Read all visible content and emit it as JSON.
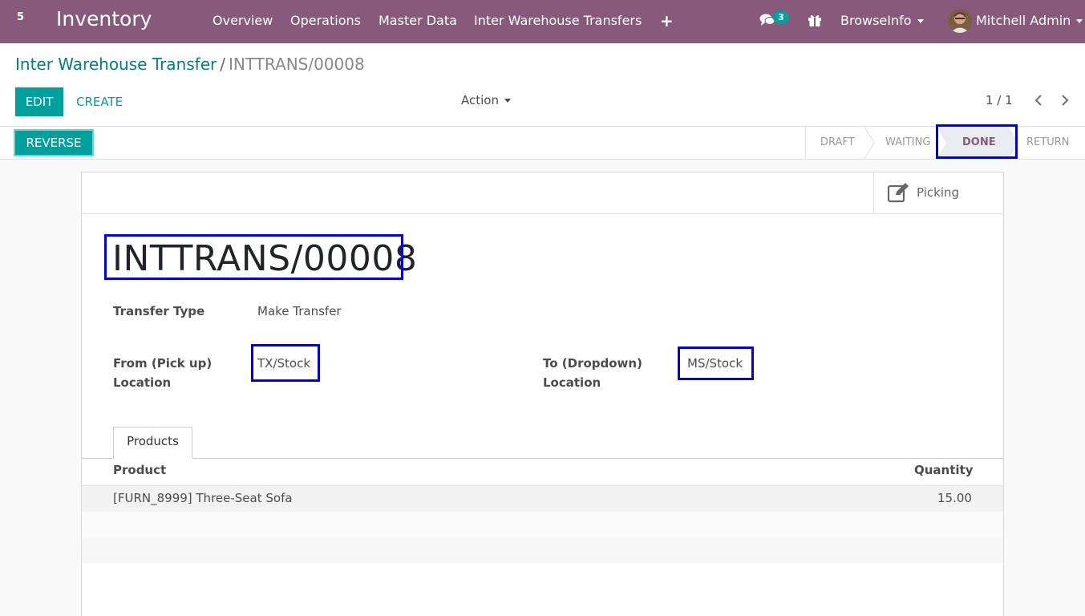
{
  "navbar": {
    "apps_count": "5",
    "brand": "Inventory",
    "menu": [
      "Overview",
      "Operations",
      "Master Data",
      "Inter Warehouse Transfers"
    ],
    "plus_icon": "+",
    "chat_badge": "3",
    "company": "BrowseInfo",
    "user": "Mitchell Admin",
    "colors": {
      "bar": "#875a7b",
      "badge": "#00a09d"
    }
  },
  "breadcrumb": {
    "parent": "Inter Warehouse Transfer",
    "separator": "/",
    "current": "INTTRANS/00008"
  },
  "buttons": {
    "edit": "EDIT",
    "create": "CREATE",
    "action": "Action",
    "reverse": "REVERSE"
  },
  "pager": {
    "value": "1 / 1"
  },
  "statusbar": {
    "stages": [
      "DRAFT",
      "WAITING",
      "DONE",
      "RETURN"
    ],
    "current": "DONE"
  },
  "sheet": {
    "smart_button": {
      "label": "Picking",
      "icon": "edit-icon"
    },
    "reference": "INTTRANS/00008",
    "fields": {
      "transfer_type": {
        "label": "Transfer Type",
        "value": "Make Transfer"
      },
      "from_location": {
        "label_line1": "From (Pick up)",
        "label_line2": "Location",
        "value": "TX/Stock"
      },
      "to_location": {
        "label_line1": "To (Dropdown)",
        "label_line2": "Location",
        "value": "MS/Stock"
      }
    },
    "tab": "Products",
    "table": {
      "headers": [
        "Product",
        "Quantity"
      ],
      "rows": [
        {
          "product": "[FURN_8999] Three-Seat Sofa",
          "quantity": "15.00"
        }
      ]
    }
  }
}
